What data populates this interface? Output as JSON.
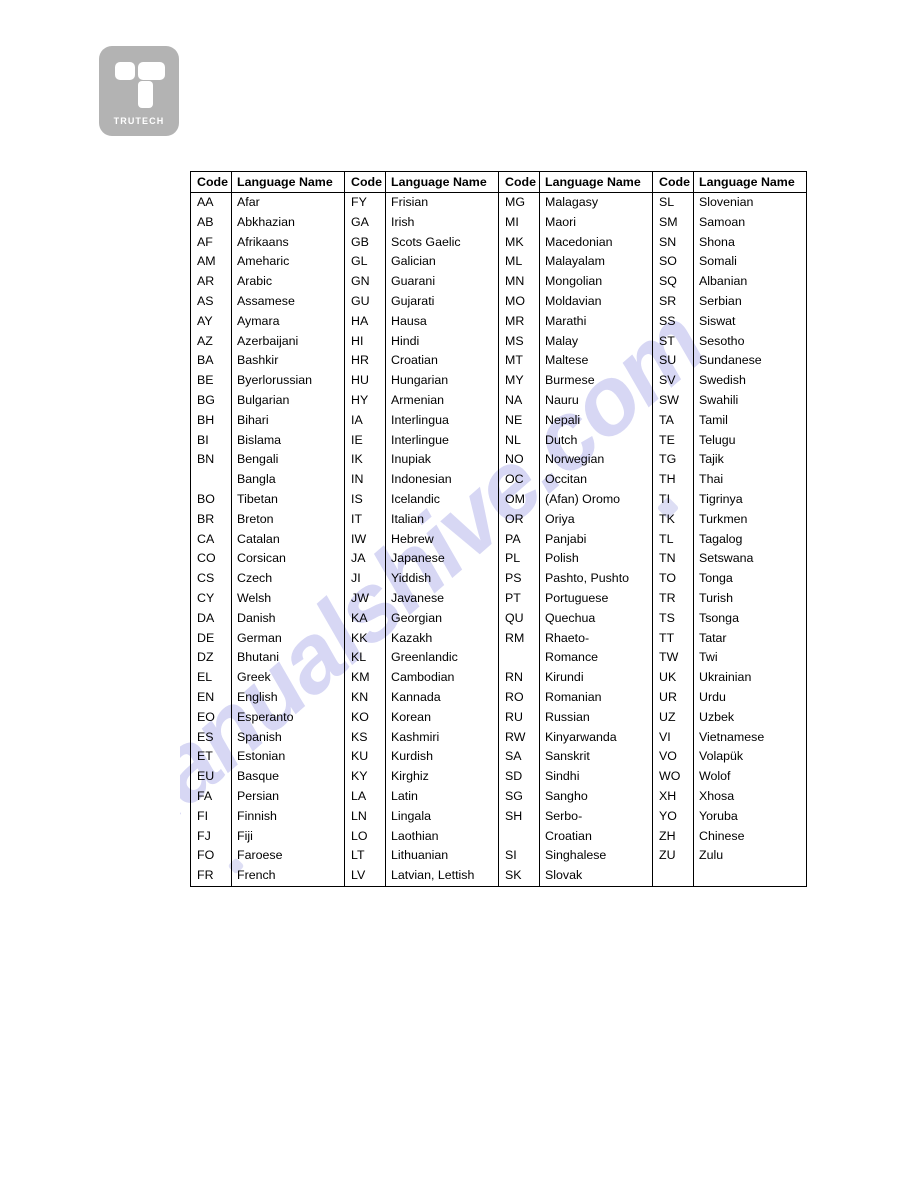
{
  "brand": {
    "name": "TRUTECH",
    "logo_icon": "trutech-logo-icon",
    "logo_color": "#b3b3b3",
    "mark_color": "#ffffff"
  },
  "watermark": {
    "text": "manualshive.com",
    "color": "#bfc0ee"
  },
  "table": {
    "name": "language-code-table",
    "header_labels": {
      "code": "Code",
      "language_name": "Language Name"
    },
    "column_groups": 4,
    "rows": [
      [
        [
          "AA",
          "Afar"
        ],
        [
          "FY",
          "Frisian"
        ],
        [
          "MG",
          "Malagasy"
        ],
        [
          "SL",
          "Slovenian"
        ]
      ],
      [
        [
          "AB",
          "Abkhazian"
        ],
        [
          "GA",
          "Irish"
        ],
        [
          "MI",
          "Maori"
        ],
        [
          "SM",
          "Samoan"
        ]
      ],
      [
        [
          "AF",
          "Afrikaans"
        ],
        [
          "GB",
          "Scots Gaelic"
        ],
        [
          "MK",
          "Macedonian"
        ],
        [
          "SN",
          "Shona"
        ]
      ],
      [
        [
          "AM",
          "Ameharic"
        ],
        [
          "GL",
          "Galician"
        ],
        [
          "ML",
          "Malayalam"
        ],
        [
          "SO",
          "Somali"
        ]
      ],
      [
        [
          "AR",
          "Arabic"
        ],
        [
          "GN",
          "Guarani"
        ],
        [
          "MN",
          "Mongolian"
        ],
        [
          "SQ",
          "Albanian"
        ]
      ],
      [
        [
          "AS",
          "Assamese"
        ],
        [
          "GU",
          "Gujarati"
        ],
        [
          "MO",
          "Moldavian"
        ],
        [
          "SR",
          "Serbian"
        ]
      ],
      [
        [
          "AY",
          "Aymara"
        ],
        [
          "HA",
          "Hausa"
        ],
        [
          "MR",
          "Marathi"
        ],
        [
          "SS",
          "Siswat"
        ]
      ],
      [
        [
          "AZ",
          "Azerbaijani"
        ],
        [
          "HI",
          "Hindi"
        ],
        [
          "MS",
          "Malay"
        ],
        [
          "ST",
          "Sesotho"
        ]
      ],
      [
        [
          "BA",
          "Bashkir"
        ],
        [
          "HR",
          "Croatian"
        ],
        [
          "MT",
          "Maltese"
        ],
        [
          "SU",
          "Sundanese"
        ]
      ],
      [
        [
          "BE",
          "Byerlorussian"
        ],
        [
          "HU",
          "Hungarian"
        ],
        [
          "MY",
          "Burmese"
        ],
        [
          "SV",
          "Swedish"
        ]
      ],
      [
        [
          "BG",
          "Bulgarian"
        ],
        [
          "HY",
          "Armenian"
        ],
        [
          "NA",
          "Nauru"
        ],
        [
          "SW",
          "Swahili"
        ]
      ],
      [
        [
          "BH",
          "Bihari"
        ],
        [
          "IA",
          "Interlingua"
        ],
        [
          "NE",
          "Nepali"
        ],
        [
          "TA",
          "Tamil"
        ]
      ],
      [
        [
          "BI",
          "Bislama"
        ],
        [
          "IE",
          "Interlingue"
        ],
        [
          "NL",
          "Dutch"
        ],
        [
          "TE",
          "Telugu"
        ]
      ],
      [
        [
          "BN",
          "Bengali"
        ],
        [
          "IK",
          "Inupiak"
        ],
        [
          "NO",
          "Norwegian"
        ],
        [
          "TG",
          "Tajik"
        ]
      ],
      [
        [
          "",
          "Bangla"
        ],
        [
          "IN",
          "Indonesian"
        ],
        [
          "OC",
          "Occitan"
        ],
        [
          "TH",
          "Thai"
        ]
      ],
      [
        [
          "BO",
          "Tibetan"
        ],
        [
          "IS",
          "Icelandic"
        ],
        [
          "OM",
          "(Afan) Oromo"
        ],
        [
          "TI",
          "Tigrinya"
        ]
      ],
      [
        [
          "BR",
          "Breton"
        ],
        [
          "IT",
          "Italian"
        ],
        [
          "OR",
          "Oriya"
        ],
        [
          "TK",
          "Turkmen"
        ]
      ],
      [
        [
          "CA",
          "Catalan"
        ],
        [
          "IW",
          "Hebrew"
        ],
        [
          "PA",
          "Panjabi"
        ],
        [
          "TL",
          "Tagalog"
        ]
      ],
      [
        [
          "CO",
          "Corsican"
        ],
        [
          "JA",
          "Japanese"
        ],
        [
          "PL",
          "Polish"
        ],
        [
          "TN",
          "Setswana"
        ]
      ],
      [
        [
          "CS",
          "Czech"
        ],
        [
          "JI",
          "Yiddish"
        ],
        [
          "PS",
          "Pashto, Pushto"
        ],
        [
          "TO",
          "Tonga"
        ]
      ],
      [
        [
          "CY",
          "Welsh"
        ],
        [
          "JW",
          "Javanese"
        ],
        [
          "PT",
          "Portuguese"
        ],
        [
          "TR",
          "Turish"
        ]
      ],
      [
        [
          "DA",
          "Danish"
        ],
        [
          "KA",
          "Georgian"
        ],
        [
          "QU",
          "Quechua"
        ],
        [
          "TS",
          "Tsonga"
        ]
      ],
      [
        [
          "DE",
          "German"
        ],
        [
          "KK",
          "Kazakh"
        ],
        [
          "RM",
          "Rhaeto-"
        ],
        [
          "TT",
          "Tatar"
        ]
      ],
      [
        [
          "DZ",
          "Bhutani"
        ],
        [
          "KL",
          "Greenlandic"
        ],
        [
          "",
          "Romance"
        ],
        [
          "TW",
          "Twi"
        ]
      ],
      [
        [
          "EL",
          "Greek"
        ],
        [
          "KM",
          "Cambodian"
        ],
        [
          "RN",
          "Kirundi"
        ],
        [
          "UK",
          "Ukrainian"
        ]
      ],
      [
        [
          "EN",
          "English"
        ],
        [
          "KN",
          "Kannada"
        ],
        [
          "RO",
          "Romanian"
        ],
        [
          "UR",
          "Urdu"
        ]
      ],
      [
        [
          "EO",
          "Esperanto"
        ],
        [
          "KO",
          "Korean"
        ],
        [
          "RU",
          "Russian"
        ],
        [
          "UZ",
          "Uzbek"
        ]
      ],
      [
        [
          "ES",
          "Spanish"
        ],
        [
          "KS",
          "Kashmiri"
        ],
        [
          "RW",
          "Kinyarwanda"
        ],
        [
          "VI",
          "Vietnamese"
        ]
      ],
      [
        [
          "ET",
          "Estonian"
        ],
        [
          "KU",
          "Kurdish"
        ],
        [
          "SA",
          "Sanskrit"
        ],
        [
          "VO",
          "Volapük"
        ]
      ],
      [
        [
          "EU",
          "Basque"
        ],
        [
          "KY",
          "Kirghiz"
        ],
        [
          "SD",
          "Sindhi"
        ],
        [
          "WO",
          "Wolof"
        ]
      ],
      [
        [
          "FA",
          "Persian"
        ],
        [
          "LA",
          "Latin"
        ],
        [
          "SG",
          "Sangho"
        ],
        [
          "XH",
          "Xhosa"
        ]
      ],
      [
        [
          "FI",
          "Finnish"
        ],
        [
          "LN",
          "Lingala"
        ],
        [
          "SH",
          "Serbo-"
        ],
        [
          "YO",
          "Yoruba"
        ]
      ],
      [
        [
          "FJ",
          "Fiji"
        ],
        [
          "LO",
          "Laothian"
        ],
        [
          "",
          "Croatian"
        ],
        [
          "ZH",
          "Chinese"
        ]
      ],
      [
        [
          "FO",
          "Faroese"
        ],
        [
          "LT",
          "Lithuanian"
        ],
        [
          "SI",
          "Singhalese"
        ],
        [
          "ZU",
          "Zulu"
        ]
      ],
      [
        [
          "FR",
          "French"
        ],
        [
          "LV",
          "Latvian, Lettish"
        ],
        [
          "SK",
          "Slovak"
        ],
        [
          "",
          ""
        ]
      ]
    ]
  }
}
